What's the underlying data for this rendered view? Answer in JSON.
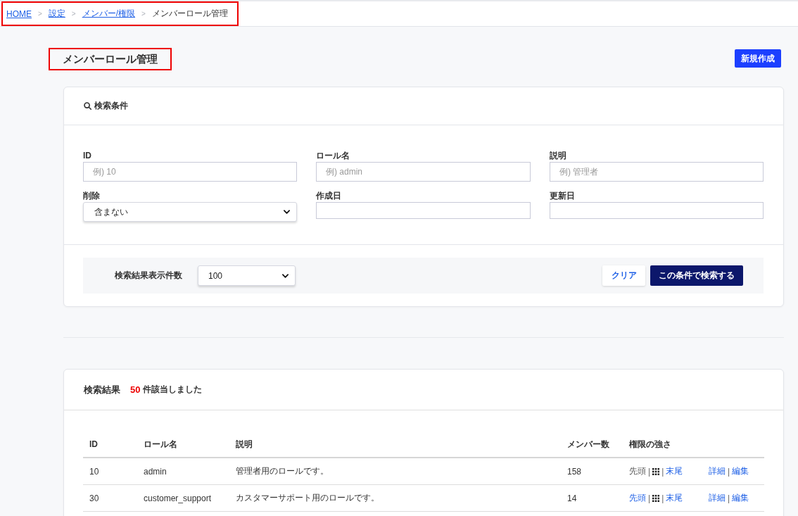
{
  "breadcrumb": {
    "highlighted": true,
    "items": [
      {
        "kind": "link",
        "label": "HOME"
      },
      {
        "kind": "separator",
        "label": ">"
      },
      {
        "kind": "link",
        "label": "設定"
      },
      {
        "kind": "separator",
        "label": ">"
      },
      {
        "kind": "link",
        "label": "メンバー/権限"
      },
      {
        "kind": "separator",
        "label": ">"
      },
      {
        "kind": "current",
        "label": "メンバーロール管理"
      }
    ]
  },
  "page_title": {
    "text": "メンバーロール管理",
    "highlighted": true
  },
  "new_button": "新規作成",
  "search_panel": {
    "title": "検索条件",
    "fields": [
      {
        "label": "ID",
        "kind": "text",
        "placeholder": "例) 10"
      },
      {
        "label": "ロール名",
        "kind": "text",
        "placeholder": "例) admin"
      },
      {
        "label": "説明",
        "kind": "text",
        "placeholder": "例) 管理者"
      },
      {
        "label": "削除",
        "kind": "select",
        "value": "含まない"
      },
      {
        "label": "作成日",
        "kind": "date"
      },
      {
        "label": "更新日",
        "kind": "date"
      }
    ],
    "page_size": {
      "label": "検索結果表示件数",
      "value": "100"
    },
    "buttons": [
      {
        "label": "クリア",
        "kind": "secondary"
      },
      {
        "label": "この条件で検索する",
        "kind": "primary"
      }
    ]
  },
  "results": {
    "title": "検索結果",
    "count": "50",
    "count_text": "件該当しました",
    "table": {
      "columns": [
        "ID",
        "ロール名",
        "説明",
        "メンバー数",
        "権限の強さ"
      ],
      "rows": [
        {
          "cells": [
            "10",
            "admin",
            "管理者用のロールです。",
            "158"
          ],
          "strength": [
            {
              "kind": "link",
              "label": "先頭",
              "disabled": true
            },
            {
              "kind": "divider",
              "label": "|"
            },
            {
              "kind": "handle"
            },
            {
              "kind": "divider",
              "label": "|"
            },
            {
              "kind": "link",
              "label": "末尾",
              "disabled": false
            }
          ],
          "actions": [
            {
              "kind": "link",
              "label": "詳細"
            },
            {
              "kind": "divider",
              "label": "|"
            },
            {
              "kind": "link",
              "label": "編集"
            }
          ]
        },
        {
          "cells": [
            "30",
            "customer_support",
            "カスタマーサポート用のロールです。",
            "14"
          ],
          "strength": [
            {
              "kind": "link",
              "label": "先頭",
              "disabled": false
            },
            {
              "kind": "divider",
              "label": "|"
            },
            {
              "kind": "handle"
            },
            {
              "kind": "divider",
              "label": "|"
            },
            {
              "kind": "link",
              "label": "末尾",
              "disabled": false
            }
          ],
          "actions": [
            {
              "kind": "link",
              "label": "詳細"
            },
            {
              "kind": "divider",
              "label": "|"
            },
            {
              "kind": "link",
              "label": "編集"
            }
          ]
        }
      ]
    }
  }
}
